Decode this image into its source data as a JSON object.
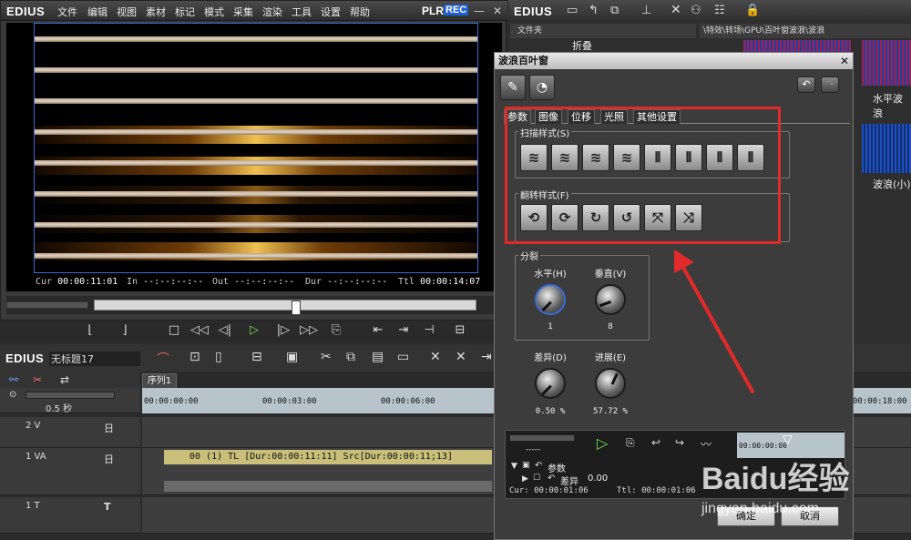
{
  "player": {
    "brand": "EDIUS",
    "menus": [
      "文件",
      "编辑",
      "视图",
      "素材",
      "标记",
      "模式",
      "采集",
      "渲染",
      "工具",
      "设置",
      "帮助"
    ],
    "plr": "PLR",
    "rec": "REC",
    "timecodes": {
      "cur_label": "Cur",
      "cur": "00:00:11:01",
      "in_label": "In",
      "in": "--:--:--:--",
      "out_label": "Out",
      "out": "--:--:--:--",
      "dur_label": "Dur",
      "dur": "--:--:--:--",
      "ttl_label": "Ttl",
      "ttl": "00:00:14:07"
    },
    "scrub_position": 0.53
  },
  "bin": {
    "brand": "EDIUS",
    "folder_header": "文件夹",
    "folder_item": "折叠",
    "path": "\\特效\\转场\\GPU\\百叶窗波浪\\波浪",
    "thumb_labels": [
      "水平波浪",
      "波浪(小)"
    ]
  },
  "timeline": {
    "brand": "EDIUS",
    "project_name": "无标题17",
    "sequence_tab": "序列1",
    "zoom": "0.5 秒",
    "ruler_ticks": [
      "00:00:00:00",
      "00:00:03:00",
      "00:00:06:00",
      "00:00:18:00"
    ],
    "tracks": [
      {
        "name": "2 V",
        "badge": "日"
      },
      {
        "name": "1 VA",
        "badge": "日"
      },
      {
        "name": "1 T",
        "badge": "T"
      }
    ],
    "clip_text": "00 (1)  TL [Dur:00:00:11:11]  Src[Dur:00:00:11;13]"
  },
  "dialog": {
    "title": "波浪百叶窗",
    "close": "✕",
    "tabs": [
      "参数",
      "图像",
      "位移",
      "光照",
      "其他设置"
    ],
    "scan_group": "扫描样式(S)",
    "flip_group": "翻转样式(F)",
    "split_group": "分裂",
    "knobs": [
      {
        "label": "水平(H)",
        "value": "1"
      },
      {
        "label": "垂直(V)",
        "value": "8"
      },
      {
        "label": "差异(D)",
        "value": "0.50 %"
      },
      {
        "label": "进展(E)",
        "value": "57.72 %"
      }
    ],
    "kf_param": "参数",
    "kf_sub": "差异",
    "kf_sub_value": "0.00",
    "kf_cur": "Cur: 00:00:01:06",
    "kf_ttl": "Ttl: 00:00:01:06",
    "kf_ruler": "00:00:00:00",
    "ok": "确定",
    "cancel": "取消"
  },
  "watermark": {
    "text": "Baidu经验",
    "url": "jingyan.baidu.com"
  },
  "colors": {
    "highlight": "#e12a2a",
    "accent": "#3a6cd8",
    "clip": "#c9be7a"
  }
}
